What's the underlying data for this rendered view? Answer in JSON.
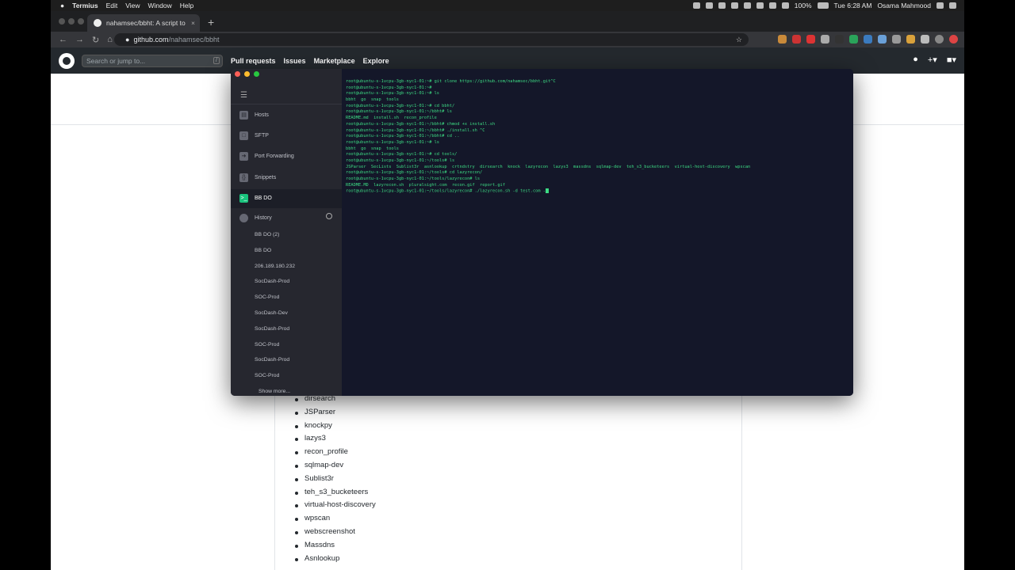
{
  "menubar": {
    "apple": "",
    "app_name": "Termius",
    "menus": [
      "Edit",
      "View",
      "Window",
      "Help"
    ],
    "battery": "100%",
    "datetime": "Tue 6:28 AM",
    "user": "Osama Mahmood"
  },
  "browser": {
    "tab_title": "nahamsec/bbht: A script to set",
    "url_host": "github.com",
    "url_path": "/nahamsec/bbht"
  },
  "github": {
    "search_placeholder": "Search or jump to...",
    "search_shortcut": "/",
    "nav": [
      "Pull requests",
      "Issues",
      "Marketplace",
      "Explore"
    ]
  },
  "readme": {
    "tools": [
      "dirsearch",
      "JSParser",
      "knockpy",
      "lazys3",
      "recon_profile",
      "sqlmap-dev",
      "Sublist3r",
      "teh_s3_bucketeers",
      "virtual-host-discovery",
      "wpscan",
      "webscreenshot",
      "Massdns",
      "Asnlookup"
    ]
  },
  "termius": {
    "sidebar": [
      {
        "label": "Hosts",
        "icon": "hosts-icon"
      },
      {
        "label": "SFTP",
        "icon": "folder-icon"
      },
      {
        "label": "Port Forwarding",
        "icon": "forward-arrow-icon"
      },
      {
        "label": "Snippets",
        "icon": "braces-icon"
      },
      {
        "label": "BB DO",
        "icon": "terminal-icon",
        "active": true
      }
    ],
    "history_label": "History",
    "history": [
      "BB DO (2)",
      "BB DO",
      "206.189.180.232",
      "SocDash-Prod",
      "SOC-Prod",
      "SocDash-Dev",
      "SocDash-Prod",
      "SOC-Prod",
      "SocDash-Prod",
      "SOC-Prod"
    ],
    "show_more": "Show more...",
    "terminal_lines": [
      "root@ubuntu-s-1vcpu-3gb-nyc1-01:~# git clone https://github.com/nahamsec/bbht.git^C",
      "root@ubuntu-s-1vcpu-3gb-nyc1-01:~#",
      "root@ubuntu-s-1vcpu-3gb-nyc1-01:~# ls",
      "bbht  go  snap  tools",
      "root@ubuntu-s-1vcpu-3gb-nyc1-01:~# cd bbht/",
      "root@ubuntu-s-1vcpu-3gb-nyc1-01:~/bbht# ls",
      "README.md  install.sh  recon_profile",
      "root@ubuntu-s-1vcpu-3gb-nyc1-01:~/bbht# chmod +x install.sh",
      "root@ubuntu-s-1vcpu-3gb-nyc1-01:~/bbht# ./install.sh ^C",
      "root@ubuntu-s-1vcpu-3gb-nyc1-01:~/bbht# cd ..",
      "root@ubuntu-s-1vcpu-3gb-nyc1-01:~# ls",
      "bbht  go  snap  tools",
      "root@ubuntu-s-1vcpu-3gb-nyc1-01:~# cd tools/",
      "root@ubuntu-s-1vcpu-3gb-nyc1-01:~/tools# ls",
      "JSParser  SecLists  Sublist3r  asnlookup  crtndstry  dirsearch  knock  lazyrecon  lazys3  massdns  sqlmap-dev  teh_s3_bucketeers  virtual-host-discovery  wpscan",
      "root@ubuntu-s-1vcpu-3gb-nyc1-01:~/tools# cd lazyrecon/",
      "root@ubuntu-s-1vcpu-3gb-nyc1-01:~/tools/lazyrecon# ls",
      "README.MD  lazyrecon.sh  pluralsight.com  recon.gif  report.gif",
      "root@ubuntu-s-1vcpu-3gb-nyc1-01:~/tools/lazyrecon# ./lazyrecon.sh -d test.com -"
    ]
  }
}
